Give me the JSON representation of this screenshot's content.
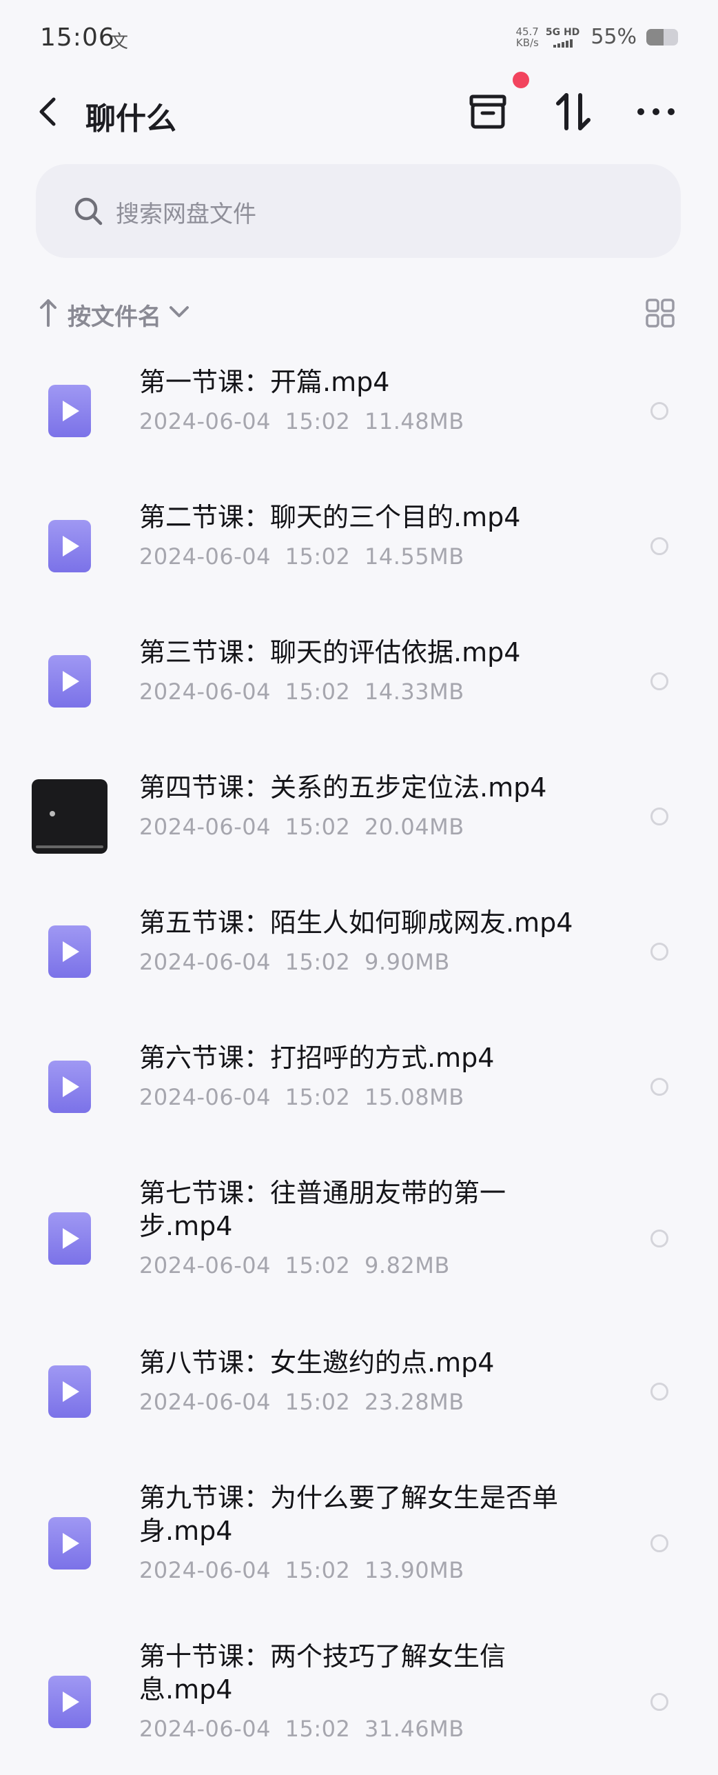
{
  "status_bar": {
    "time": "15:06",
    "net_speed": "45.7",
    "net_unit": "KB/s",
    "net_type": "5G HD",
    "battery": "55%",
    "battery_level": 0.55
  },
  "header": {
    "title": "聊什么"
  },
  "search": {
    "placeholder": "搜索网盘文件"
  },
  "sort": {
    "label": "按文件名"
  },
  "files": [
    {
      "name_line1": "第一节课：开篇.mp4",
      "name_line2": "",
      "date": "2024-06-04",
      "time": "15:02",
      "size": "11.48MB",
      "thumb": "video-icon"
    },
    {
      "name_line1": "第二节课：聊天的三个目的.mp4",
      "name_line2": "",
      "date": "2024-06-04",
      "time": "15:02",
      "size": "14.55MB",
      "thumb": "video-icon"
    },
    {
      "name_line1": "第三节课：聊天的评估依据.mp4",
      "name_line2": "",
      "date": "2024-06-04",
      "time": "15:02",
      "size": "14.33MB",
      "thumb": "video-icon"
    },
    {
      "name_line1": "第四节课：关系的五步定位法.mp4",
      "name_line2": "",
      "date": "2024-06-04",
      "time": "15:02",
      "size": "20.04MB",
      "thumb": "video-thumbnail"
    },
    {
      "name_line1": "第五节课：陌生人如何聊成网友.mp4",
      "name_line2": "",
      "date": "2024-06-04",
      "time": "15:02",
      "size": "9.90MB",
      "thumb": "video-icon"
    },
    {
      "name_line1": "第六节课：打招呼的方式.mp4",
      "name_line2": "",
      "date": "2024-06-04",
      "time": "15:02",
      "size": "15.08MB",
      "thumb": "video-icon"
    },
    {
      "name_line1": "第七节课：往普通朋友带的第一",
      "name_line2": "步.mp4",
      "date": "2024-06-04",
      "time": "15:02",
      "size": "9.82MB",
      "thumb": "video-icon"
    },
    {
      "name_line1": "第八节课：女生邀约的点.mp4",
      "name_line2": "",
      "date": "2024-06-04",
      "time": "15:02",
      "size": "23.28MB",
      "thumb": "video-icon"
    },
    {
      "name_line1": "第九节课：为什么要了解女生是否单",
      "name_line2": "身.mp4",
      "date": "2024-06-04",
      "time": "15:02",
      "size": "13.90MB",
      "thumb": "video-icon"
    },
    {
      "name_line1": "第十节课：两个技巧了解女生信",
      "name_line2": "息.mp4",
      "date": "2024-06-04",
      "time": "15:02",
      "size": "31.46MB",
      "thumb": "video-icon"
    }
  ],
  "colors": {
    "accent_icon": "#8a82ee",
    "notification_dot": "#f2445e",
    "background": "#f7f7fa"
  }
}
